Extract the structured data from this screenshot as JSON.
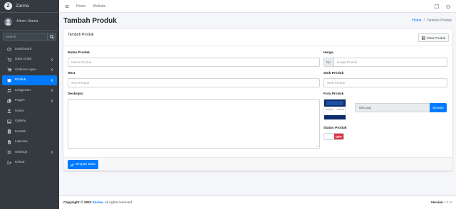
{
  "brand": {
    "logo_letter": "Z",
    "name": "Zarina"
  },
  "user": {
    "name": "Admin Utama"
  },
  "sidebar_search": {
    "placeholder": "Search"
  },
  "sidebar": {
    "items": [
      {
        "label": "Dashboard",
        "icon": "tachometer-icon",
        "has_chevron": false,
        "active": false
      },
      {
        "label": "Data Order",
        "icon": "shopping-cart-icon",
        "has_chevron": true,
        "active": false
      },
      {
        "label": "Orderan Agen",
        "icon": "cart-icon",
        "has_chevron": true,
        "active": false
      },
      {
        "label": "Produk",
        "icon": "box-icon",
        "has_chevron": true,
        "active": true
      },
      {
        "label": "Keagenan",
        "icon": "users-icon",
        "has_chevron": true,
        "active": false
      },
      {
        "label": "Pages",
        "icon": "copy-icon",
        "has_chevron": true,
        "active": false
      },
      {
        "label": "Users",
        "icon": "user-icon",
        "has_chevron": false,
        "active": false
      },
      {
        "label": "Gallery",
        "icon": "image-icon",
        "has_chevron": false,
        "active": false
      },
      {
        "label": "Kontak",
        "icon": "address-book-icon",
        "has_chevron": false,
        "active": false
      },
      {
        "label": "Laporan",
        "icon": "file-icon",
        "has_chevron": false,
        "active": false
      },
      {
        "label": "Settings",
        "icon": "settings-icon",
        "has_chevron": true,
        "active": false
      },
      {
        "label": "Keluar",
        "icon": "sign-out-icon",
        "has_chevron": false,
        "active": false
      }
    ]
  },
  "topnav": {
    "home": "Home",
    "website": "Website"
  },
  "page": {
    "title": "Tambah Produk"
  },
  "breadcrumb": {
    "home": "Home",
    "separator": "/",
    "current": "Tambah Produk"
  },
  "card": {
    "title": "Tambah Produk",
    "data_button": "Data Produk"
  },
  "form": {
    "nama": {
      "label": "Nama Produk",
      "placeholder": "Nama Produk"
    },
    "harga": {
      "label": "Harga",
      "prefix": "Rp.",
      "placeholder": "Harga Produk"
    },
    "sku": {
      "label": "SKU",
      "placeholder": "SKU Produk"
    },
    "stok": {
      "label": "Stok Produk",
      "placeholder": "Stok Produk"
    },
    "deskripsi": {
      "label": "Deskripsi"
    },
    "foto": {
      "label": "Foto Produk",
      "file_name": "004.png",
      "browse": "Browse"
    },
    "status": {
      "label": "Status Produk",
      "toggle_text": "OFF"
    },
    "save_button": "Simpan Data"
  },
  "footer": {
    "copyright_prefix": "Copyright © 2022",
    "brand": "Zarina.",
    "rights": "All rights reserved.",
    "version_label": "Version",
    "version_value": "1.1.0"
  },
  "colors": {
    "primary": "#007bff",
    "sidebar_bg": "#343a40",
    "danger": "#dc3545"
  }
}
